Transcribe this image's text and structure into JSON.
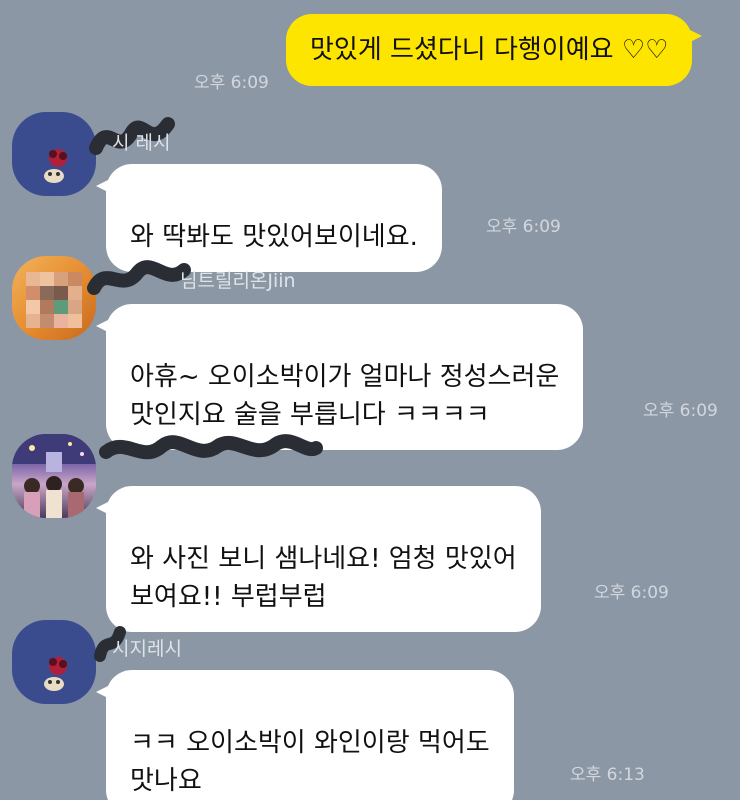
{
  "colors": {
    "chat_background": "#8c97a6",
    "my_bubble": "#fee500",
    "their_bubble": "#ffffff"
  },
  "messages": [
    {
      "from": "me",
      "text": "맛있게 드셨다니 다행이예요 ♡♡",
      "time": "오후 6:09"
    },
    {
      "from": "other",
      "sender_name_visible": "시  레시",
      "avatar": "dark-blue-character-avatar",
      "text": "와 딱봐도 맛있어보이네요.",
      "time": "오후 6:09"
    },
    {
      "from": "other",
      "sender_name_visible": "님트릴리온Jiin",
      "avatar": "blurred-orange-avatar",
      "text": "아휴~ 오이소박이가 얼마나 정성스러운\n맛인지요 술을 부릅니다 ㅋㅋㅋㅋ",
      "time": "오후 6:09"
    },
    {
      "from": "other",
      "sender_name_visible": "",
      "avatar": "group-photo-avatar",
      "text": "와 사진 보니 샘나네요! 엄청 맛있어\n보여요!! 부럽부럽",
      "time": "오후 6:09"
    },
    {
      "from": "other",
      "sender_name_visible": "시지레시",
      "avatar": "dark-blue-character-avatar",
      "text": "ㅋㅋ 오이소박이 와인이랑 먹어도\n맛나요",
      "time": "오후 6:13"
    }
  ]
}
